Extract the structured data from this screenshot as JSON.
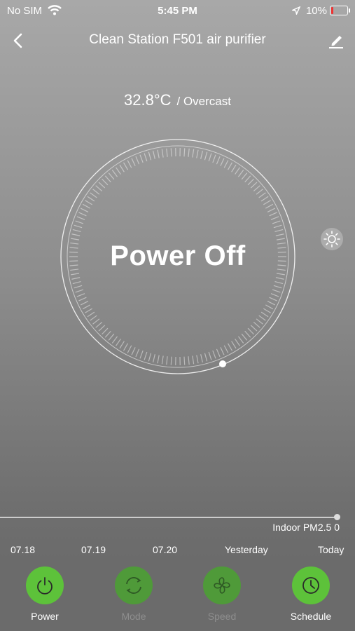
{
  "status_bar": {
    "carrier": "No SIM",
    "time": "5:45 PM",
    "battery": "10%"
  },
  "header": {
    "title": "Clean Station F501 air purifier"
  },
  "weather": {
    "temperature": "32.8°C",
    "condition": "/ Overcast"
  },
  "device": {
    "state": "Power Off"
  },
  "pm": {
    "label": "Indoor PM2.5",
    "value": "0",
    "dates": [
      "07.18",
      "07.19",
      "07.20",
      "Yesterday",
      "Today"
    ]
  },
  "controls": [
    {
      "label": "Power",
      "icon": "power-icon",
      "enabled": true
    },
    {
      "label": "Mode",
      "icon": "mode-cycle-icon",
      "enabled": false
    },
    {
      "label": "Speed",
      "icon": "fan-icon",
      "enabled": false
    },
    {
      "label": "Schedule",
      "icon": "clock-icon",
      "enabled": true
    }
  ],
  "colors": {
    "accent": "#5dc23a",
    "accent_dim": "#4f9a39",
    "battery_low": "#e33333"
  }
}
